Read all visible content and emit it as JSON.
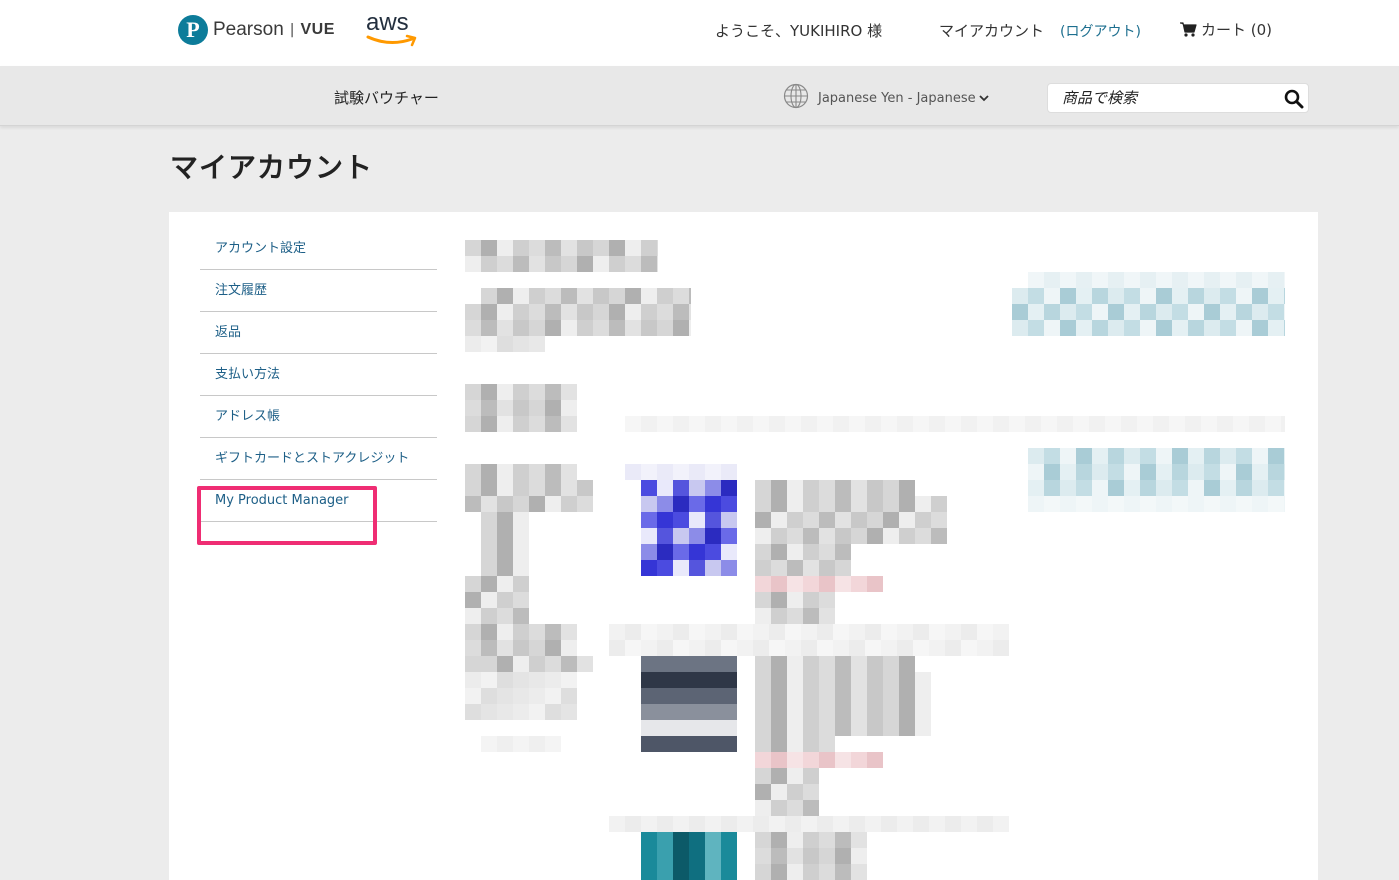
{
  "header": {
    "brand_pearson": "Pearson",
    "brand_separator": "|",
    "brand_vue": "VUE",
    "brand_aws": "aws",
    "welcome": "ようこそ、YUKIHIRO 様",
    "my_account": "マイアカウント",
    "logout": "(ログアウト)",
    "cart": "カート (0)"
  },
  "nav": {
    "voucher": "試験バウチャー",
    "currency_language": "Japanese Yen - Japanese",
    "search_placeholder": "商品で検索"
  },
  "page": {
    "title": "マイアカウント"
  },
  "sidebar": {
    "items": [
      {
        "label": "アカウント設定"
      },
      {
        "label": "注文履歴"
      },
      {
        "label": "返品"
      },
      {
        "label": "支払い方法"
      },
      {
        "label": "アドレス帳"
      },
      {
        "label": "ギフトカードとストアクレジット"
      },
      {
        "label": "My Product Manager",
        "highlighted": true
      }
    ]
  },
  "colors": {
    "brand_teal": "#0d7c9a",
    "link": "#1d5f87",
    "highlight": "#ef2d73",
    "aws_orange": "#ff9900"
  },
  "icons": [
    "pearson-logo-icon",
    "aws-smile-icon",
    "cart-icon",
    "globe-icon",
    "chevron-down-icon",
    "search-icon"
  ]
}
